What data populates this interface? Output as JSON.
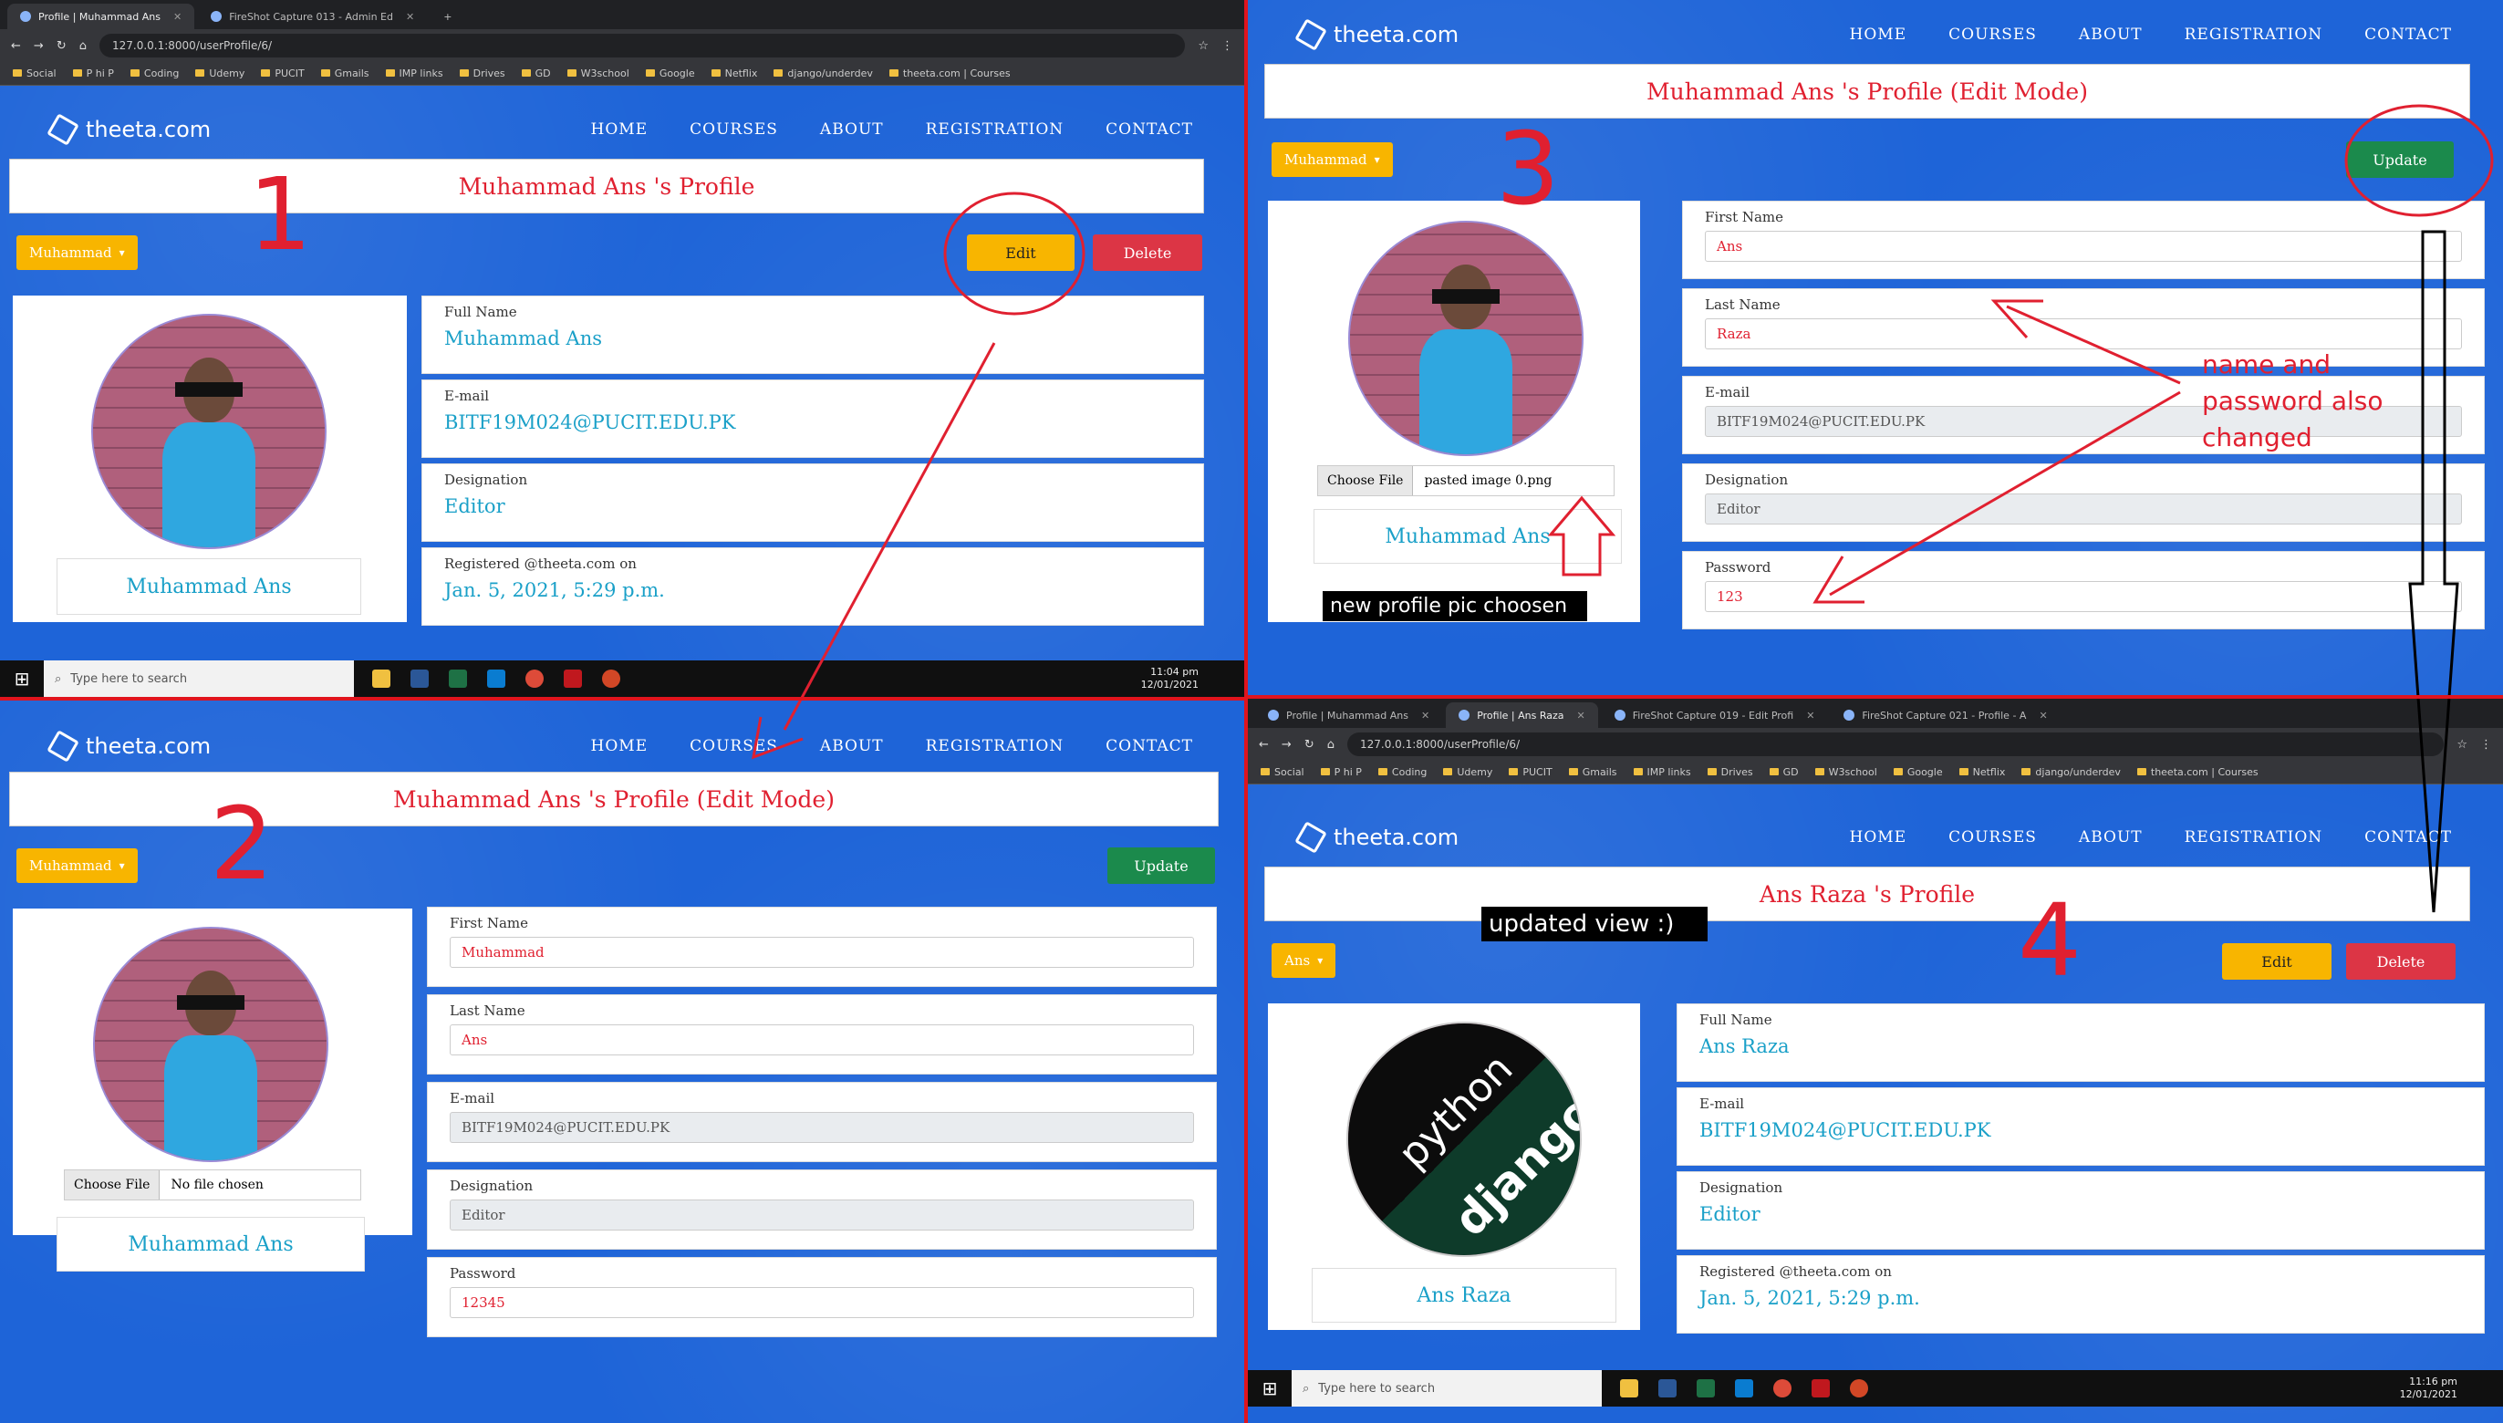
{
  "site": {
    "logo": "theeta.com",
    "nav": [
      "HOME",
      "COURSES",
      "ABOUT",
      "REGISTRATION",
      "CONTACT"
    ]
  },
  "browser": {
    "tabs_q1": [
      "Profile | Muhammad Ans",
      "FireShot Capture 013 - Admin Ed"
    ],
    "tabs_q4": [
      "Profile | Muhammad Ans",
      "Profile | Ans Raza",
      "FireShot Capture 019 - Edit Profi",
      "FireShot Capture 021 - Profile - A"
    ],
    "url": "127.0.0.1:8000/userProfile/6/",
    "bookmarks": [
      "Social",
      "P hi P",
      "Coding",
      "Udemy",
      "PUCIT",
      "Gmails",
      "IMP links",
      "Drives",
      "GD",
      "W3school",
      "Google",
      "Netflix",
      "django/underdev",
      "theeta.com | Courses"
    ]
  },
  "taskbar": {
    "search_placeholder": "Type here to search",
    "time_q1": "11:04 pm",
    "date_q1": "12/01/2021",
    "time_q4": "11:16 pm",
    "date_q4": "12/01/2021"
  },
  "q1": {
    "title": "Muhammad Ans 's Profile",
    "dropdown": "Muhammad",
    "edit": "Edit",
    "delete": "Delete",
    "name": "Muhammad Ans",
    "fields": [
      {
        "label": "Full Name",
        "value": "Muhammad Ans"
      },
      {
        "label": "E-mail",
        "value": "BITF19M024@PUCIT.EDU.PK"
      },
      {
        "label": "Designation",
        "value": "Editor"
      },
      {
        "label": "Registered @theeta.com on",
        "value": "Jan. 5, 2021, 5:29 p.m."
      }
    ]
  },
  "q2": {
    "title": "Muhammad Ans 's Profile (Edit Mode)",
    "dropdown": "Muhammad",
    "update": "Update",
    "choose_file": "Choose File",
    "file_text": "No file chosen",
    "name": "Muhammad Ans",
    "fields": [
      {
        "label": "First Name",
        "value": "Muhammad"
      },
      {
        "label": "Last Name",
        "value": "Ans"
      },
      {
        "label": "E-mail",
        "value": "BITF19M024@PUCIT.EDU.PK"
      },
      {
        "label": "Designation",
        "value": "Editor"
      },
      {
        "label": "Password",
        "value": "12345"
      }
    ]
  },
  "q3": {
    "title": "Muhammad Ans 's Profile (Edit Mode)",
    "dropdown": "Muhammad",
    "update": "Update",
    "choose_file": "Choose File",
    "file_text": "pasted image 0.png",
    "name": "Muhammad Ans",
    "fields": [
      {
        "label": "First Name",
        "value": "Ans"
      },
      {
        "label": "Last Name",
        "value": "Raza"
      },
      {
        "label": "E-mail",
        "value": "BITF19M024@PUCIT.EDU.PK"
      },
      {
        "label": "Designation",
        "value": "Editor"
      },
      {
        "label": "Password",
        "value": "123"
      }
    ]
  },
  "q4": {
    "title": "Ans Raza 's Profile",
    "dropdown": "Ans",
    "edit": "Edit",
    "delete": "Delete",
    "name": "Ans Raza",
    "avatar_text_1": "python",
    "avatar_text_2": "django",
    "fields": [
      {
        "label": "Full Name",
        "value": "Ans Raza"
      },
      {
        "label": "E-mail",
        "value": "BITF19M024@PUCIT.EDU.PK"
      },
      {
        "label": "Designation",
        "value": "Editor"
      },
      {
        "label": "Registered @theeta.com on",
        "value": "Jan. 5, 2021, 5:29 p.m."
      }
    ]
  },
  "annotations": {
    "n1": "1",
    "n2": "2",
    "n3": "3",
    "n4": "4",
    "new_pic": "new profile pic choosen",
    "name_pass_1": "name and",
    "name_pass_2": "password also",
    "name_pass_3": "changed",
    "updated_view": "updated view :)"
  },
  "colors": {
    "accent": "#1e64d8",
    "title_red": "#e02030",
    "edit_yellow": "#f8b500",
    "delete_red": "#dc3545",
    "update_green": "#1b8a4c",
    "value_blue": "#1aa0c8"
  }
}
